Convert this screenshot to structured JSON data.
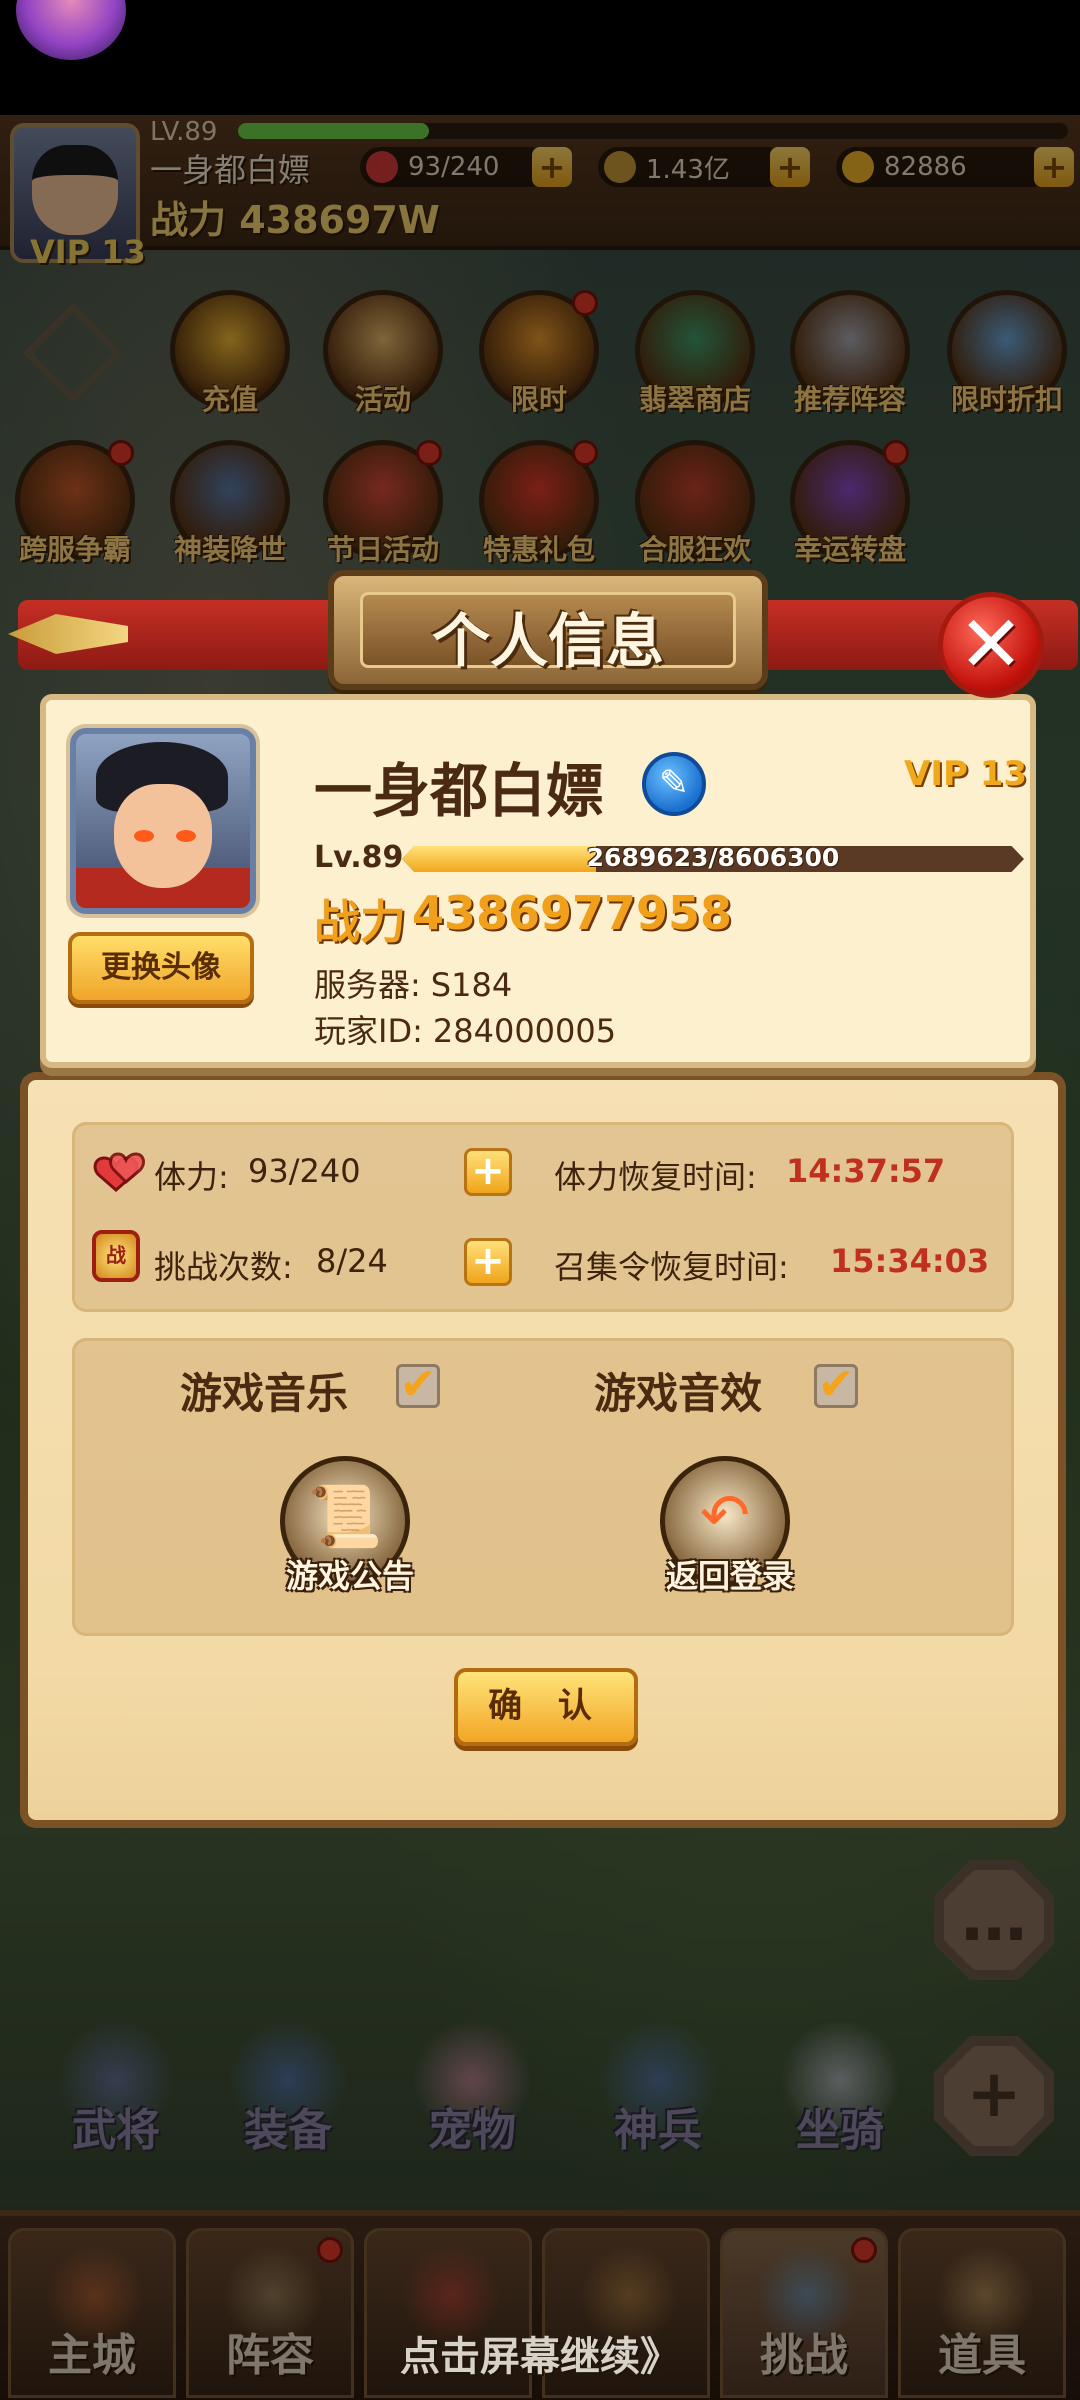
{
  "hud": {
    "level": "LV.89",
    "name": "一身都白嫖",
    "power": "战力 438697W",
    "vip": "VIP 13",
    "stamina": "93/240",
    "coins": "1.43亿",
    "gems": "82886",
    "exp_fraction": 0.23
  },
  "activities": [
    {
      "label": "充值",
      "color": "#f0b733"
    },
    {
      "label": "活动",
      "color": "#e7b86a"
    },
    {
      "label": "限时",
      "color": "#e8982c"
    },
    {
      "label": "翡翠商店",
      "color": "#3f9b6a"
    },
    {
      "label": "推荐阵容",
      "color": "#a8a8b0"
    },
    {
      "label": "限时折扣",
      "color": "#6aa6d8"
    },
    {
      "label": "跨服争霸",
      "color": "#c75a2a"
    },
    {
      "label": "神装降世",
      "color": "#5a7aa8"
    },
    {
      "label": "节日活动",
      "color": "#d84a3a"
    },
    {
      "label": "特惠礼包",
      "color": "#e23a2a"
    },
    {
      "label": "合服狂欢",
      "color": "#c3402d"
    },
    {
      "label": "幸运转盘",
      "color": "#8a4ac8"
    }
  ],
  "modal": {
    "title": "个人信息",
    "close": "✕",
    "name": "一身都白嫖",
    "vip": "VIP 13",
    "level": "Lv.89",
    "exp_text": "2689623/8606300",
    "exp_fraction": 0.3125,
    "power_label": "战力",
    "power_value": "4386977958",
    "change_avatar": "更换头像",
    "server_label": "服务器:",
    "server_value": "S184",
    "player_id_label": "玩家ID:",
    "player_id_value": "284000005",
    "stamina_label": "体力:",
    "stamina_value": "93/240",
    "stamina_recover_label": "体力恢复时间:",
    "stamina_recover_value": "14:37:57",
    "challenge_label": "挑战次数:",
    "challenge_value": "8/24",
    "summon_recover_label": "召集令恢复时间:",
    "summon_recover_value": "15:34:03",
    "music_label": "游戏音乐",
    "sfx_label": "游戏音效",
    "music_on": true,
    "sfx_on": true,
    "notice_label": "游戏公告",
    "back_login_label": "返回登录",
    "confirm_label": "确 认",
    "check_mark": "✔",
    "plus": "+"
  },
  "hero_bar": [
    "武将",
    "装备",
    "宠物",
    "神兵",
    "坐骑"
  ],
  "bottom_nav": [
    {
      "label": "主城",
      "active": false
    },
    {
      "label": "阵容",
      "active": false
    },
    {
      "label": "",
      "active": false
    },
    {
      "label": "",
      "active": false
    },
    {
      "label": "挑战",
      "active": true
    },
    {
      "label": "道具",
      "active": false
    }
  ],
  "continue_hint": "点击屏幕继续》"
}
